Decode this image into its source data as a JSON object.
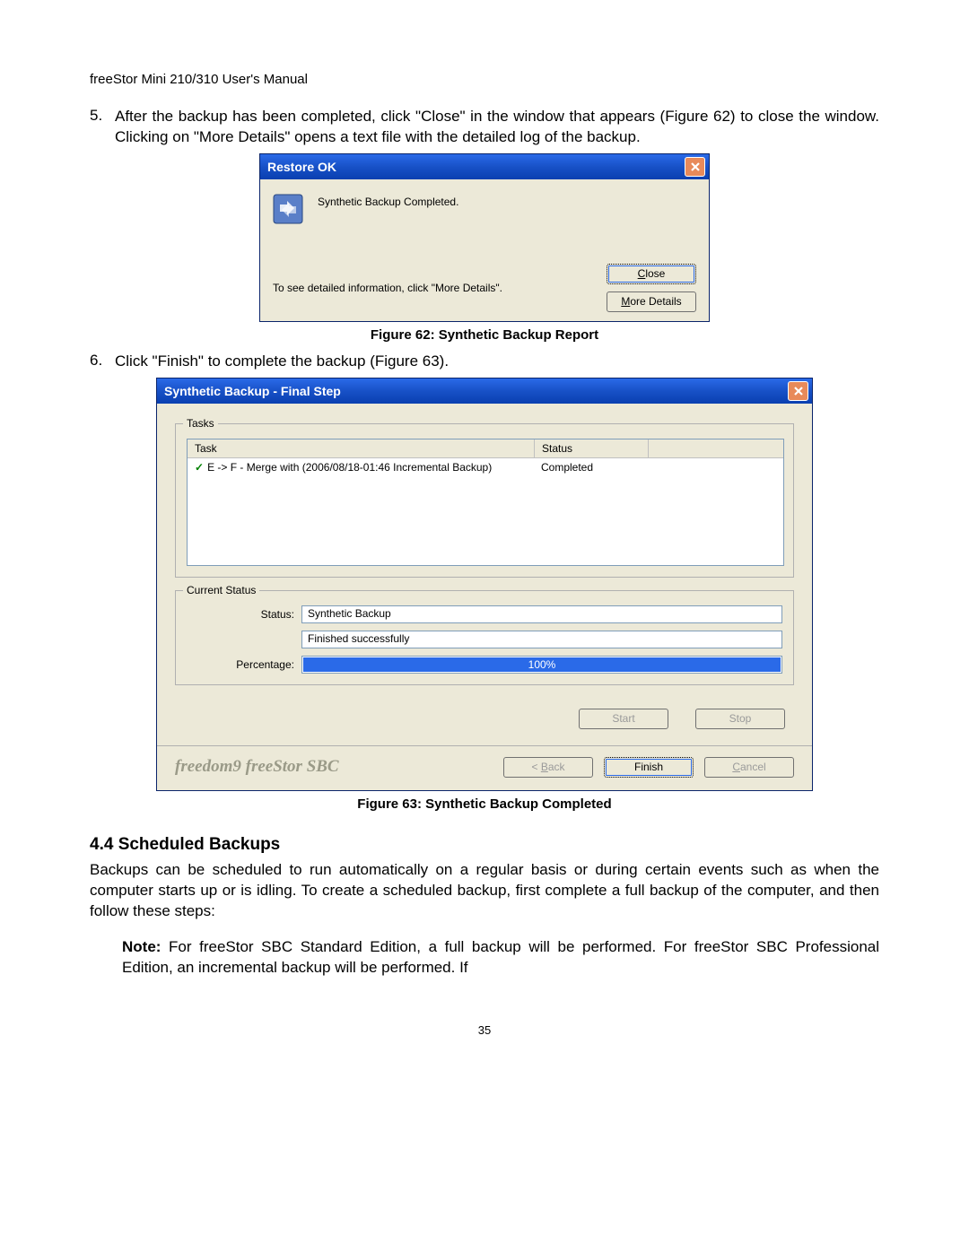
{
  "header": "freeStor Mini 210/310 User's Manual",
  "step5_num": "5.",
  "step5": "After the backup has been completed, click \"Close\" in the window that appears (Figure 62) to close the window.  Clicking on \"More Details\" opens a text file with the detailed log of the backup.",
  "dlg1": {
    "title": "Restore OK",
    "message": "Synthetic Backup Completed.",
    "detail_text": "To see detailed information, click \"More Details\".",
    "close_btn_prefix": "",
    "close_btn_underline": "C",
    "close_btn_suffix": "lose",
    "more_btn_prefix": "",
    "more_btn_underline": "M",
    "more_btn_suffix": "ore Details"
  },
  "fig62_caption": "Figure 62: Synthetic Backup Report",
  "step6_num": "6.",
  "step6": "Click \"Finish\" to complete the backup (Figure 63).",
  "dlg2": {
    "title": "Synthetic Backup - Final Step",
    "tasks_legend": "Tasks",
    "task_col_task": "Task",
    "task_col_status": "Status",
    "task_row_task": "E -> F - Merge with (2006/08/18-01:46 Incremental Backup)",
    "task_row_status": "Completed",
    "current_legend": "Current Status",
    "label_status": "Status:",
    "field_status1": "Synthetic Backup",
    "field_status2": "Finished successfully",
    "label_percentage": "Percentage:",
    "progress_pct": "100%",
    "start_btn": "Start",
    "stop_btn": "Stop",
    "brand": "freedom9 freeStor SBC",
    "back_prefix": "< ",
    "back_underline": "B",
    "back_suffix": "ack",
    "finish_btn": "Finish",
    "cancel_prefix": "",
    "cancel_underline": "C",
    "cancel_suffix": "ancel"
  },
  "fig63_caption": "Figure 63: Synthetic Backup Completed",
  "section_heading": "4.4    Scheduled Backups",
  "section_body": "Backups can be scheduled to run automatically on a regular basis or during certain events such as when the computer starts up or is idling.  To create a scheduled backup, first complete a full backup of the computer, and then follow these steps:",
  "note_label": "Note:",
  "note_body": " For freeStor SBC Standard Edition, a full backup will be performed.  For freeStor SBC Professional Edition, an incremental backup will be performed.  If",
  "page_number": "35"
}
